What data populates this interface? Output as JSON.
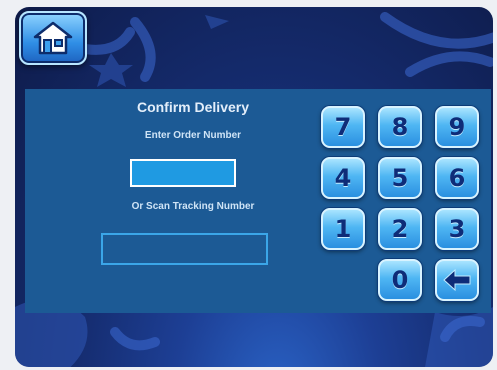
{
  "header": {
    "home_icon": "home-icon"
  },
  "form": {
    "title": "Confirm Delivery",
    "enter_label": "Enter Order Number",
    "order_value": "",
    "scan_label": "Or Scan Tracking Number",
    "tracking_value": ""
  },
  "keypad": {
    "keys": [
      "7",
      "8",
      "9",
      "4",
      "5",
      "6",
      "1",
      "2",
      "3",
      "0"
    ],
    "backspace_icon": "backspace-arrow-icon"
  },
  "colors": {
    "panel": "#1c5a95",
    "key": "#4fb6f3",
    "key_text": "#0e2c78",
    "order_field": "#1f9ae2"
  }
}
